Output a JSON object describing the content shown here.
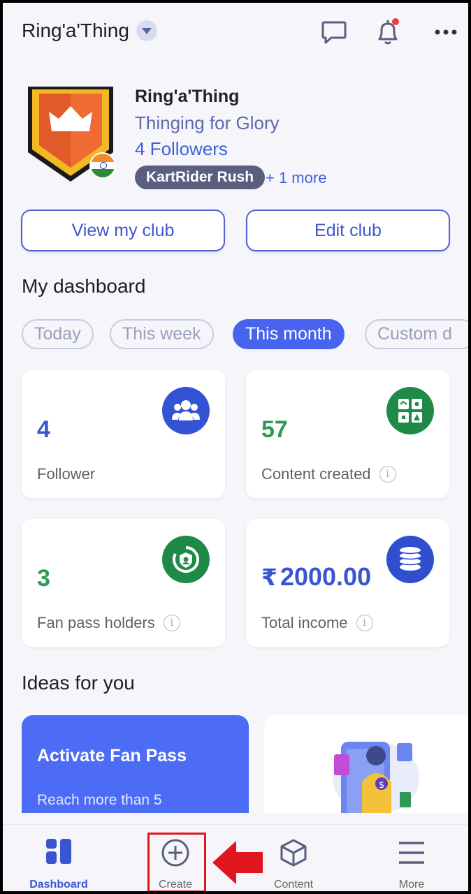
{
  "header": {
    "club_switch_name": "Ring'a'Thing",
    "icons": [
      "chat-icon",
      "bell-icon",
      "more-vert-icon"
    ],
    "notification_dot_color": "#e8403a"
  },
  "club": {
    "name": "Ring'a'Thing",
    "tagline": "Thinging for Glory",
    "followers": "4 Followers",
    "game_chip": "KartRider Rush",
    "more_games": "+ 1 more",
    "flag": "india-flag"
  },
  "actions": {
    "view_club": "View my club",
    "edit_club": "Edit club"
  },
  "dashboard": {
    "title": "My dashboard",
    "filters": [
      {
        "label": "Today",
        "selected": false
      },
      {
        "label": "This week",
        "selected": false
      },
      {
        "label": "This month",
        "selected": true
      },
      {
        "label": "Custom d",
        "selected": false
      }
    ],
    "cards": [
      {
        "value": "4",
        "label": "Follower",
        "icon": "users-icon",
        "color": "#3452d4"
      },
      {
        "value": "57",
        "label": "Content created",
        "icon": "grid-content-icon",
        "color": "#1f8a48"
      },
      {
        "value": "3",
        "label": "Fan pass holders",
        "icon": "fan-pass-icon",
        "color": "#1f8a48"
      },
      {
        "currency": "₹",
        "value": "2000.00",
        "label": "Total income",
        "icon": "coins-icon",
        "color": "#2f4fcf"
      }
    ]
  },
  "ideas": {
    "title": "Ideas for you",
    "cards": [
      {
        "title": "Activate Fan Pass",
        "subtitle": "Reach more than 5"
      }
    ]
  },
  "nav": {
    "items": [
      {
        "label": "Dashboard",
        "icon": "dashboard-icon",
        "active": true
      },
      {
        "label": "Create",
        "icon": "plus-circle-icon",
        "active": false
      },
      {
        "label": "Content",
        "icon": "cube-icon",
        "active": false
      },
      {
        "label": "More",
        "icon": "hamburger-icon",
        "active": false
      }
    ]
  },
  "colors": {
    "accent": "#4763ef",
    "highlight": "#e0151e"
  }
}
